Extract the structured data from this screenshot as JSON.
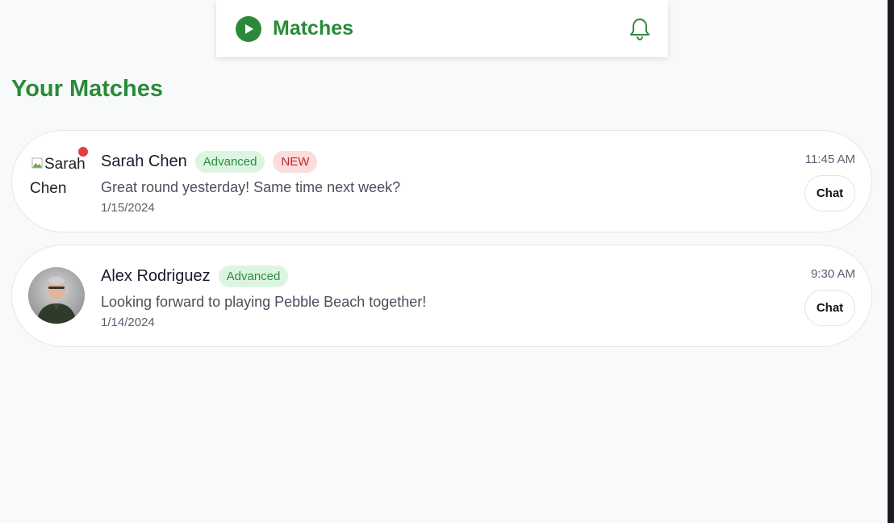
{
  "header": {
    "title": "Matches",
    "brand_icon": "play-circle-icon",
    "notification_icon": "bell-icon",
    "accent_color": "#2a8a3a"
  },
  "page": {
    "heading": "Your Matches"
  },
  "matches": [
    {
      "name": "Sarah Chen",
      "avatar_alt": "Sarah Chen",
      "avatar_state": "broken-image",
      "unread_indicator": true,
      "level": "Advanced",
      "new_badge": "NEW",
      "last_message": "Great round yesterday! Same time next week?",
      "date": "1/15/2024",
      "time": "11:45 AM",
      "chat_label": "Chat"
    },
    {
      "name": "Alex Rodriguez",
      "avatar_alt": "Alex Rodriguez",
      "avatar_state": "photo",
      "unread_indicator": false,
      "level": "Advanced",
      "last_message": "Looking forward to playing Pebble Beach together!",
      "date": "1/14/2024",
      "time": "9:30 AM",
      "chat_label": "Chat"
    }
  ]
}
